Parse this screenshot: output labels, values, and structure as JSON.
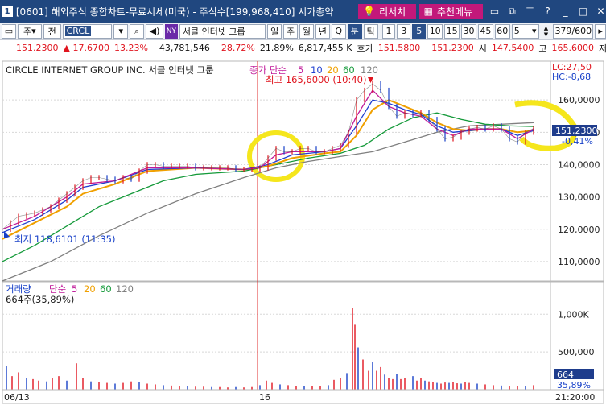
{
  "titlebar": {
    "window_number": "1",
    "title": "[0601] 해외주식 종합차트-무료시세(미국) - 주식수[199,968,410] 시가총약",
    "research_label": "리서치",
    "recommend_label": "추천메뉴",
    "icons": [
      "restore-icon",
      "dock-icon",
      "pin-icon",
      "help-icon",
      "minimize-icon",
      "maximize-icon",
      "close-icon"
    ]
  },
  "toolbar": {
    "type_label": "주",
    "period_label": "전",
    "symbol": "CRCL",
    "market_badge": "NY",
    "company_short": "서클 인터넷 그룹",
    "timeframes": [
      "일",
      "주",
      "월",
      "년",
      "Q",
      "분",
      "틱"
    ],
    "active_timeframe": "분",
    "intervals": [
      "1",
      "3",
      "5",
      "10",
      "15",
      "30",
      "45",
      "60"
    ],
    "active_interval": "5",
    "select_value": "5",
    "count_value": "379",
    "count_total": "/600"
  },
  "quote": {
    "price": "151.2300",
    "change": "▲ 17.6700",
    "change_pct": "13.23%",
    "volume": "43,781,546",
    "pct2": "28.72%",
    "pct3": "21.89%",
    "amount": "6,817,455 K",
    "bid_label": "호가",
    "bid": "151.5800",
    "price2": "151.2300",
    "open_label": "시",
    "open": "147.5400",
    "high_label": "고",
    "high": "165.6000",
    "low_label": "저"
  },
  "chart_data": {
    "type": "line",
    "symbol_title": "CIRCLE INTERNET GROUP INC.  서클 인터넷 그룹",
    "ma_label": "종가 단순",
    "ma_periods": [
      "5",
      "10",
      "20",
      "60",
      "120"
    ],
    "ma_colors": [
      "#c01a9a",
      "#1f3fd0",
      "#f0a000",
      "#159a3a",
      "#808080"
    ],
    "lc_label": "LC:27,50",
    "hc_label": "HC:-8,68",
    "max_annotation": "최고 165,6000 (10:40)",
    "min_annotation": "최저 118,6101 (11:35)",
    "current_price_label": "151,2300",
    "current_change_label": "-0,41%",
    "y_ticks": [
      "160,0000",
      "150,0000",
      "140,0000",
      "130,0000",
      "120,0000",
      "110,0000"
    ],
    "y_tick_values": [
      160,
      150,
      140,
      130,
      120,
      110
    ],
    "ylim": [
      104,
      172
    ],
    "x_labels": [
      "06/13",
      "16"
    ],
    "time_label": "21:20:00",
    "price_path": [
      [
        0,
        120
      ],
      [
        10,
        122
      ],
      [
        20,
        124
      ],
      [
        30,
        124.5
      ],
      [
        40,
        125
      ],
      [
        50,
        126
      ],
      [
        60,
        127
      ],
      [
        70,
        129
      ],
      [
        80,
        131
      ],
      [
        90,
        133
      ],
      [
        100,
        135
      ],
      [
        110,
        136
      ],
      [
        120,
        136
      ],
      [
        130,
        135.5
      ],
      [
        140,
        135
      ],
      [
        150,
        136
      ],
      [
        160,
        135.5
      ],
      [
        170,
        138
      ],
      [
        180,
        140
      ],
      [
        190,
        140
      ],
      [
        200,
        139.5
      ],
      [
        210,
        139.5
      ],
      [
        220,
        139.5
      ],
      [
        230,
        139.5
      ],
      [
        240,
        139
      ],
      [
        250,
        139
      ],
      [
        260,
        139
      ],
      [
        270,
        139
      ],
      [
        280,
        139
      ],
      [
        290,
        138.5
      ],
      [
        300,
        138.5
      ],
      [
        310,
        138.5
      ],
      [
        320,
        139
      ],
      [
        330,
        142
      ],
      [
        340,
        145
      ],
      [
        350,
        144
      ],
      [
        360,
        144
      ],
      [
        370,
        145
      ],
      [
        380,
        145
      ],
      [
        390,
        144
      ],
      [
        400,
        144
      ],
      [
        410,
        145
      ],
      [
        420,
        146
      ],
      [
        430,
        150
      ],
      [
        440,
        160
      ],
      [
        450,
        163
      ],
      [
        460,
        165
      ],
      [
        470,
        163
      ],
      [
        480,
        158
      ],
      [
        490,
        155
      ],
      [
        500,
        156
      ],
      [
        510,
        155.5
      ],
      [
        520,
        156
      ],
      [
        530,
        154
      ],
      [
        540,
        151
      ],
      [
        550,
        148
      ],
      [
        560,
        148.5
      ],
      [
        570,
        150
      ],
      [
        580,
        151
      ],
      [
        590,
        151.5
      ],
      [
        600,
        151
      ],
      [
        610,
        152
      ],
      [
        620,
        151
      ],
      [
        630,
        148
      ],
      [
        640,
        147
      ],
      [
        650,
        150
      ],
      [
        660,
        151.2
      ]
    ],
    "ma_paths": {
      "ma5": [
        [
          0,
          120
        ],
        [
          40,
          124
        ],
        [
          80,
          130
        ],
        [
          100,
          134
        ],
        [
          140,
          135
        ],
        [
          180,
          139
        ],
        [
          240,
          139
        ],
        [
          300,
          138.5
        ],
        [
          320,
          139
        ],
        [
          340,
          143
        ],
        [
          360,
          144
        ],
        [
          400,
          144
        ],
        [
          420,
          145
        ],
        [
          440,
          155
        ],
        [
          460,
          163
        ],
        [
          480,
          158
        ],
        [
          500,
          156
        ],
        [
          520,
          155
        ],
        [
          540,
          151
        ],
        [
          560,
          149
        ],
        [
          580,
          151
        ],
        [
          600,
          151
        ],
        [
          620,
          151
        ],
        [
          640,
          148
        ],
        [
          660,
          151
        ]
      ],
      "ma10": [
        [
          0,
          119
        ],
        [
          40,
          123
        ],
        [
          80,
          129
        ],
        [
          100,
          133
        ],
        [
          140,
          135
        ],
        [
          180,
          138.5
        ],
        [
          240,
          139
        ],
        [
          300,
          138.5
        ],
        [
          330,
          140
        ],
        [
          360,
          143
        ],
        [
          400,
          144
        ],
        [
          420,
          145
        ],
        [
          440,
          152
        ],
        [
          460,
          160
        ],
        [
          480,
          159
        ],
        [
          500,
          157
        ],
        [
          520,
          155.5
        ],
        [
          540,
          152
        ],
        [
          560,
          150
        ],
        [
          580,
          150.5
        ],
        [
          600,
          151
        ],
        [
          620,
          151
        ],
        [
          640,
          149
        ],
        [
          660,
          150.5
        ]
      ],
      "ma20": [
        [
          0,
          117
        ],
        [
          40,
          122
        ],
        [
          80,
          127
        ],
        [
          100,
          131
        ],
        [
          140,
          134
        ],
        [
          180,
          138
        ],
        [
          240,
          139
        ],
        [
          300,
          138.5
        ],
        [
          330,
          139.5
        ],
        [
          360,
          142
        ],
        [
          400,
          143.5
        ],
        [
          420,
          144
        ],
        [
          440,
          149
        ],
        [
          460,
          157
        ],
        [
          480,
          160
        ],
        [
          500,
          158
        ],
        [
          520,
          156
        ],
        [
          540,
          153
        ],
        [
          560,
          151
        ],
        [
          580,
          150.5
        ],
        [
          600,
          151
        ],
        [
          620,
          151
        ],
        [
          640,
          150
        ],
        [
          660,
          150.5
        ]
      ],
      "ma60": [
        [
          0,
          110
        ],
        [
          40,
          115
        ],
        [
          80,
          121
        ],
        [
          120,
          127
        ],
        [
          160,
          131
        ],
        [
          200,
          135
        ],
        [
          240,
          137
        ],
        [
          300,
          138
        ],
        [
          340,
          140
        ],
        [
          380,
          142
        ],
        [
          420,
          143.5
        ],
        [
          450,
          146
        ],
        [
          480,
          151
        ],
        [
          510,
          154.5
        ],
        [
          540,
          156
        ],
        [
          570,
          154
        ],
        [
          600,
          152.5
        ],
        [
          630,
          152
        ],
        [
          660,
          151.8
        ]
      ],
      "ma120": [
        [
          0,
          104
        ],
        [
          60,
          110
        ],
        [
          120,
          118
        ],
        [
          180,
          125
        ],
        [
          240,
          131
        ],
        [
          300,
          136
        ],
        [
          340,
          139
        ],
        [
          380,
          141
        ],
        [
          420,
          142.5
        ],
        [
          460,
          144
        ],
        [
          500,
          147
        ],
        [
          540,
          150
        ],
        [
          580,
          152
        ],
        [
          620,
          152.5
        ],
        [
          660,
          153
        ]
      ]
    },
    "volume_label": "거래량",
    "volume_ma_label": "단순",
    "volume_ma_periods": [
      "5",
      "20",
      "60",
      "120"
    ],
    "volume_info": "664주(35,89%)",
    "volume_y_ticks": [
      "1,000K",
      "500,000"
    ],
    "volume_y_tick_values": [
      1000,
      500
    ],
    "volume_ylim": [
      0,
      1430
    ],
    "volume_current_label": "664",
    "volume_current_pct": "35,89%",
    "volume_bars": [
      [
        5,
        320
      ],
      [
        12,
        180
      ],
      [
        20,
        230
      ],
      [
        30,
        150
      ],
      [
        38,
        140
      ],
      [
        45,
        120
      ],
      [
        55,
        110
      ],
      [
        62,
        150
      ],
      [
        70,
        180
      ],
      [
        80,
        120
      ],
      [
        92,
        350
      ],
      [
        100,
        160
      ],
      [
        110,
        110
      ],
      [
        120,
        100
      ],
      [
        130,
        90
      ],
      [
        140,
        80
      ],
      [
        150,
        90
      ],
      [
        160,
        110
      ],
      [
        170,
        100
      ],
      [
        180,
        80
      ],
      [
        190,
        70
      ],
      [
        200,
        60
      ],
      [
        210,
        55
      ],
      [
        220,
        50
      ],
      [
        230,
        45
      ],
      [
        240,
        40
      ],
      [
        250,
        40
      ],
      [
        260,
        35
      ],
      [
        270,
        35
      ],
      [
        280,
        30
      ],
      [
        290,
        35
      ],
      [
        300,
        30
      ],
      [
        310,
        35
      ],
      [
        320,
        60
      ],
      [
        328,
        120
      ],
      [
        335,
        90
      ],
      [
        345,
        70
      ],
      [
        355,
        60
      ],
      [
        365,
        50
      ],
      [
        375,
        50
      ],
      [
        385,
        45
      ],
      [
        395,
        45
      ],
      [
        405,
        60
      ],
      [
        412,
        130
      ],
      [
        420,
        150
      ],
      [
        428,
        220
      ],
      [
        435,
        1080
      ],
      [
        438,
        860
      ],
      [
        442,
        560
      ],
      [
        448,
        400
      ],
      [
        455,
        250
      ],
      [
        460,
        370
      ],
      [
        465,
        250
      ],
      [
        470,
        300
      ],
      [
        475,
        200
      ],
      [
        480,
        160
      ],
      [
        485,
        140
      ],
      [
        490,
        210
      ],
      [
        495,
        140
      ],
      [
        500,
        160
      ],
      [
        510,
        180
      ],
      [
        515,
        120
      ],
      [
        520,
        150
      ],
      [
        525,
        120
      ],
      [
        530,
        110
      ],
      [
        535,
        100
      ],
      [
        540,
        90
      ],
      [
        545,
        80
      ],
      [
        550,
        95
      ],
      [
        555,
        90
      ],
      [
        560,
        100
      ],
      [
        565,
        85
      ],
      [
        570,
        80
      ],
      [
        575,
        100
      ],
      [
        580,
        90
      ],
      [
        590,
        80
      ],
      [
        600,
        70
      ],
      [
        610,
        60
      ],
      [
        620,
        55
      ],
      [
        630,
        50
      ],
      [
        640,
        45
      ],
      [
        650,
        50
      ],
      [
        660,
        60
      ]
    ]
  }
}
